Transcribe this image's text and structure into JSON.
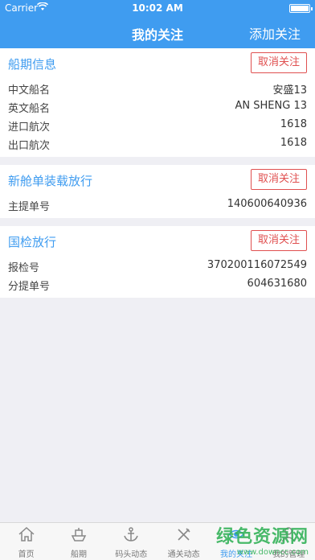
{
  "status_bar": {
    "carrier": "Carrier",
    "time": "10:02 AM"
  },
  "nav": {
    "title": "我的关注",
    "action": "添加关注"
  },
  "cards": [
    {
      "title": "船期信息",
      "button": "取消关注",
      "rows": [
        {
          "label": "中文船名",
          "value": "安盛13"
        },
        {
          "label": "英文船名",
          "value": "AN SHENG 13"
        },
        {
          "label": "进口航次",
          "value": "1618"
        },
        {
          "label": "出口航次",
          "value": "1618"
        }
      ]
    },
    {
      "title": "新舱单装载放行",
      "button": "取消关注",
      "rows": [
        {
          "label": "主提单号",
          "value": "140600640936"
        }
      ]
    },
    {
      "title": "国检放行",
      "button": "取消关注",
      "rows": [
        {
          "label": "报检号",
          "value": "370200116072549"
        },
        {
          "label": "分提单号",
          "value": "604631680"
        }
      ]
    }
  ],
  "tabs": [
    {
      "label": "首页",
      "icon": "home-icon"
    },
    {
      "label": "船期",
      "icon": "ship-icon"
    },
    {
      "label": "码头动态",
      "icon": "anchor-icon"
    },
    {
      "label": "通关动态",
      "icon": "tools-icon"
    },
    {
      "label": "我的关注",
      "icon": "eye-icon"
    },
    {
      "label": "我的管理",
      "icon": "user-icon"
    }
  ],
  "active_tab": 4,
  "accent_color": "#3f9cf0",
  "danger_color": "#e05050",
  "watermark": {
    "big": "绿色资源网",
    "small": "www.downcc.com"
  }
}
